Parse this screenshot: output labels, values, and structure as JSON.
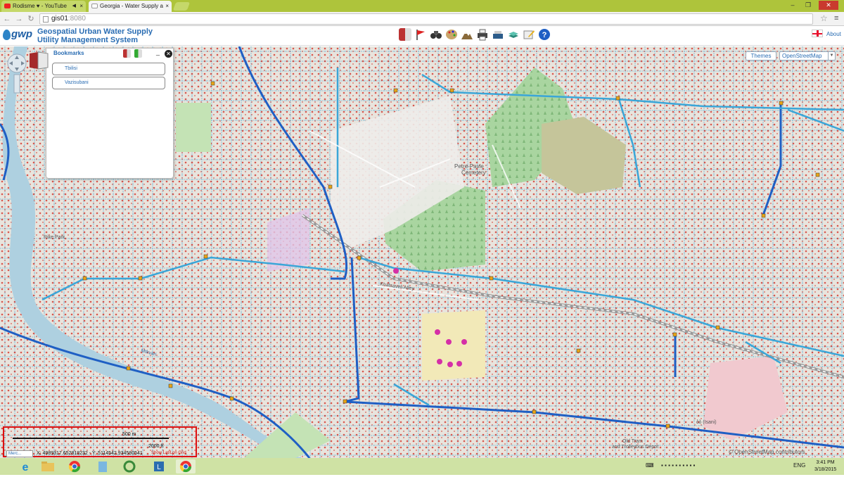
{
  "browser": {
    "tabs": [
      {
        "label": "Rodisme ♥ - YouTube",
        "icon": "youtube-icon",
        "muted_icon": "speaker-icon",
        "close": "×"
      },
      {
        "label": "Georgia - Water Supply a",
        "icon": "page-icon",
        "close": "×"
      }
    ],
    "window": {
      "minimize": "–",
      "maximize": "❐",
      "close": "✕"
    },
    "url_host": "gis01",
    "url_port": ":8080",
    "nav": {
      "back": "←",
      "forward": "→",
      "reload": "↻"
    }
  },
  "app": {
    "logo_text": "gwp",
    "title_line1": "Geospatial Urban Water Supply",
    "title_line2": "Utility Management System",
    "about_label": "About",
    "language_flag": "georgia-flag-icon",
    "toolbar_icons": [
      "bookmark-book-icon",
      "red-flag-icon",
      "binoculars-icon",
      "palette-icon",
      "terrain-icon",
      "printer-icon",
      "fax-printer-icon",
      "layers-stack-icon",
      "edit-pencil-icon",
      "help-icon"
    ],
    "colors": {
      "accent": "#2a6db3",
      "pipe_main": "#1f5fc4",
      "pipe_secondary": "#3aa6d8",
      "valve": "#d2281f",
      "header_bar": "#aec43b"
    }
  },
  "map": {
    "themes_button": "Themes",
    "basemap_select": "OpenStreetMap",
    "attribution": "© OpenStreetMap contributors",
    "place_labels": [
      "Rike Park",
      "Petre-Pavle",
      "Cemetery",
      "Old Tram",
      "and Trolleybus Depot"
    ],
    "street_labels": [
      "Rike Park",
      "Mtkvari",
      "Khatsaveli Alley",
      "ბბ (Isani)"
    ],
    "bookmarks": {
      "title": "Bookmarks",
      "minimize": "_",
      "close": "✕",
      "items": [
        "Tbilisi",
        "Vazisubani"
      ]
    },
    "scale": {
      "metric": "500 m",
      "imperial": "2000 ft"
    },
    "coordinates": {
      "projection": "Merc...",
      "text": "X: 4989317.652818232 - Y: 5114542.934580541",
      "latlon_toggle": "Show Lat/Lon Grid"
    }
  },
  "taskbar": {
    "apps": [
      "internet-explorer-icon",
      "file-explorer-icon",
      "chrome-icon",
      "notepad-icon",
      "qgis-icon",
      "lync-icon",
      "chrome-icon"
    ],
    "language": "ENG",
    "time": "3:41 PM",
    "date": "3/18/2015"
  }
}
